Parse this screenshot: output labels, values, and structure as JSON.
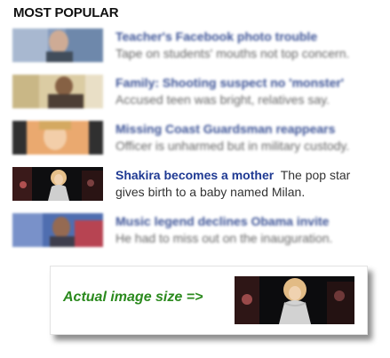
{
  "section": {
    "title": "MOST POPULAR"
  },
  "stories": [
    {
      "headline": "Teacher's Facebook photo trouble",
      "summary": "Tape on students' mouths not top concern."
    },
    {
      "headline": "Family: Shooting suspect no 'monster'",
      "summary": "Accused teen was bright, relatives say."
    },
    {
      "headline": "Missing Coast Guardsman reappears",
      "summary": "Officer is unharmed but in military custody."
    },
    {
      "headline": "Shakira becomes a mother",
      "summary": "The pop star gives birth to a baby named Milan."
    },
    {
      "headline": "Music legend declines Obama invite",
      "summary": "He had to miss out on the inauguration."
    }
  ],
  "callout": {
    "label": "Actual image size =>"
  },
  "colors": {
    "headline": "#27408b",
    "callout_label": "#2b8a1e"
  }
}
